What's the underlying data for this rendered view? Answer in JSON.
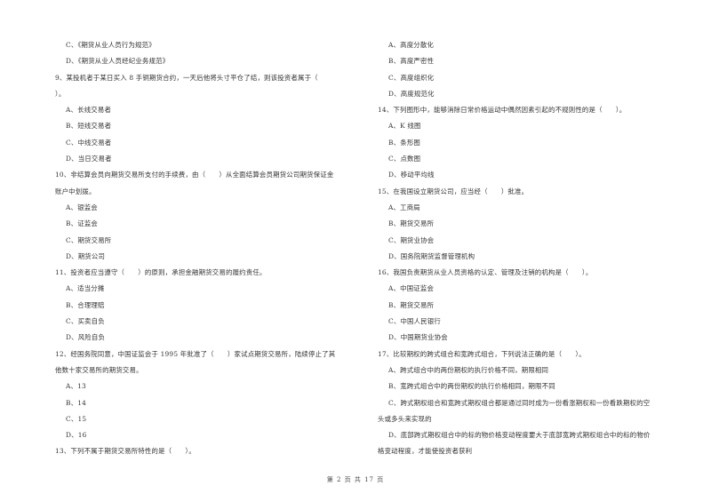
{
  "left_column": [
    {
      "type": "opt",
      "text": "C、《期货从业人员行为规范》"
    },
    {
      "type": "opt",
      "text": "D、《期货从业人员经纪业务规范》"
    },
    {
      "type": "q",
      "text": "9、某投机者于某日买入 8 手铜期货合约，一天后他将头寸平仓了结，则该投资者属于（"
    },
    {
      "type": "cont",
      "text": "）。"
    },
    {
      "type": "opt",
      "text": "A、长线交易者"
    },
    {
      "type": "opt",
      "text": "B、短线交易者"
    },
    {
      "type": "opt",
      "text": "C、中线交易者"
    },
    {
      "type": "opt",
      "text": "D、当日交易者"
    },
    {
      "type": "q",
      "text": "10、非结算会员向期货交易所支付的手续费，由（　　）从全面结算会员期货公司期货保证金"
    },
    {
      "type": "cont",
      "text": "账户中划拨。"
    },
    {
      "type": "opt",
      "text": "A、银监会"
    },
    {
      "type": "opt",
      "text": "B、证监会"
    },
    {
      "type": "opt",
      "text": "C、期货交易所"
    },
    {
      "type": "opt",
      "text": "D、期货公司"
    },
    {
      "type": "q",
      "text": "11、投资者应当遵守（　　）的原则，承担金融期货交易的履约责任。"
    },
    {
      "type": "opt",
      "text": "A、适当分摊"
    },
    {
      "type": "opt",
      "text": "B、合理理赔"
    },
    {
      "type": "opt",
      "text": "C、买卖自负"
    },
    {
      "type": "opt",
      "text": "D、风险自负"
    },
    {
      "type": "q",
      "text": "12、经国务院同意，中国证监会于 1995 年批准了（　　）家试点期货交易所，陆续停止了其"
    },
    {
      "type": "cont",
      "text": "他数十家交易所的期货交易。"
    },
    {
      "type": "opt",
      "text": "A、13"
    },
    {
      "type": "opt",
      "text": "B、14"
    },
    {
      "type": "opt",
      "text": "C、15"
    },
    {
      "type": "opt",
      "text": "D、16"
    },
    {
      "type": "q",
      "text": "13、下列不属于期货交易所特性的是（　　）。"
    }
  ],
  "right_column": [
    {
      "type": "opt",
      "text": "A、高度分散化"
    },
    {
      "type": "opt",
      "text": "B、高度严密性"
    },
    {
      "type": "opt",
      "text": "C、高度组织化"
    },
    {
      "type": "opt",
      "text": "D、高度规范化"
    },
    {
      "type": "q",
      "text": "14、下列图形中，能够消除日常价格运动中偶然因素引起的不规则性的是（　　）。"
    },
    {
      "type": "opt",
      "text": "A、K 线图"
    },
    {
      "type": "opt",
      "text": "B、条形图"
    },
    {
      "type": "opt",
      "text": "C、点数图"
    },
    {
      "type": "opt",
      "text": "D、移动平均线"
    },
    {
      "type": "q",
      "text": "15、在我国设立期货公司，应当经（　　）批准。"
    },
    {
      "type": "opt",
      "text": "A、工商局"
    },
    {
      "type": "opt",
      "text": "B、期货交易所"
    },
    {
      "type": "opt",
      "text": "C、期货业协会"
    },
    {
      "type": "opt",
      "text": "D、国务院期货监督管理机构"
    },
    {
      "type": "q",
      "text": "16、我国负责期货从业人员资格的认定、管理及注销的机构是（　　）。"
    },
    {
      "type": "opt",
      "text": "A、中国证监会"
    },
    {
      "type": "opt",
      "text": "B、期货交易所"
    },
    {
      "type": "opt",
      "text": "C、中国人民银行"
    },
    {
      "type": "opt",
      "text": "D、中国期货业协会"
    },
    {
      "type": "q",
      "text": "17、比较期权的跨式组合和宽跨式组合，下列说法正确的是（　　）。"
    },
    {
      "type": "opt",
      "text": "A、跨式组合中的两份期权的执行价格不同，期限相同"
    },
    {
      "type": "opt",
      "text": "B、宽跨式组合中的两份期权的执行价格相同，期限不同"
    },
    {
      "type": "opt",
      "text": "C、跨式期权组合和宽跨式期权组合都是通过同时成为一份看涨期权和一份看跌期权的空"
    },
    {
      "type": "cont",
      "text": "头或多头来实现的"
    },
    {
      "type": "opt",
      "text": "D、底部跨式期权组合中的标的物价格变动程度要大于底部宽跨式期权组合中的标的物价"
    },
    {
      "type": "cont",
      "text": "格变动程度，才能使投资者获利"
    }
  ],
  "footer": {
    "page_label": "第 2 页 共 17 页"
  }
}
